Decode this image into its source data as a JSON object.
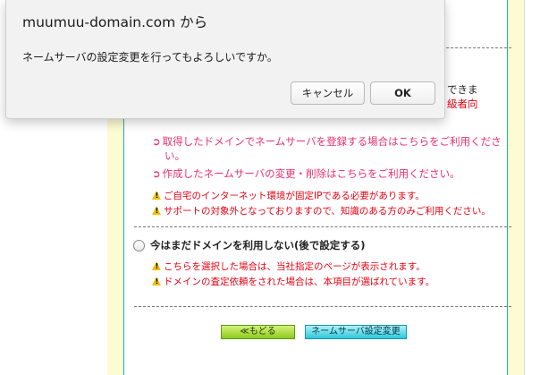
{
  "page": {
    "top_right_text_1": "できま",
    "top_right_text_2": "級者向",
    "section_a": {
      "items": [
        "取得したドメインでネームサーバを登録する場合はこちらをご利用くださ",
        "い。",
        "作成したネームサーバの変更・削除はこちらをご利用ください。"
      ],
      "warnings": [
        "ご自宅のインターネット環境が固定IPである必要があります。",
        "サポートの対象外となっておりますので、知識のある方のみご利用ください。"
      ]
    },
    "option_later": {
      "label": "今はまだドメインを利用しない(後で設定する)",
      "warnings": [
        "こちらを選択した場合は、当社指定のページが表示されます。",
        "ドメインの査定依頼をされた場合は、本項目が選ばれています。"
      ]
    },
    "buttons": {
      "back": "≪もどる",
      "change": "ネームサーバ設定変更"
    }
  },
  "dialog": {
    "title": "muumuu-domain.com から",
    "message": "ネームサーバの設定変更を行ってもよろしいですか。",
    "cancel": "キャンセル",
    "ok": "OK"
  },
  "colors": {
    "accent_pink": "#e8316f",
    "warning_red": "#e60012",
    "panel_border": "#19b0c4",
    "yellow_bg": "#fdfbd2"
  }
}
